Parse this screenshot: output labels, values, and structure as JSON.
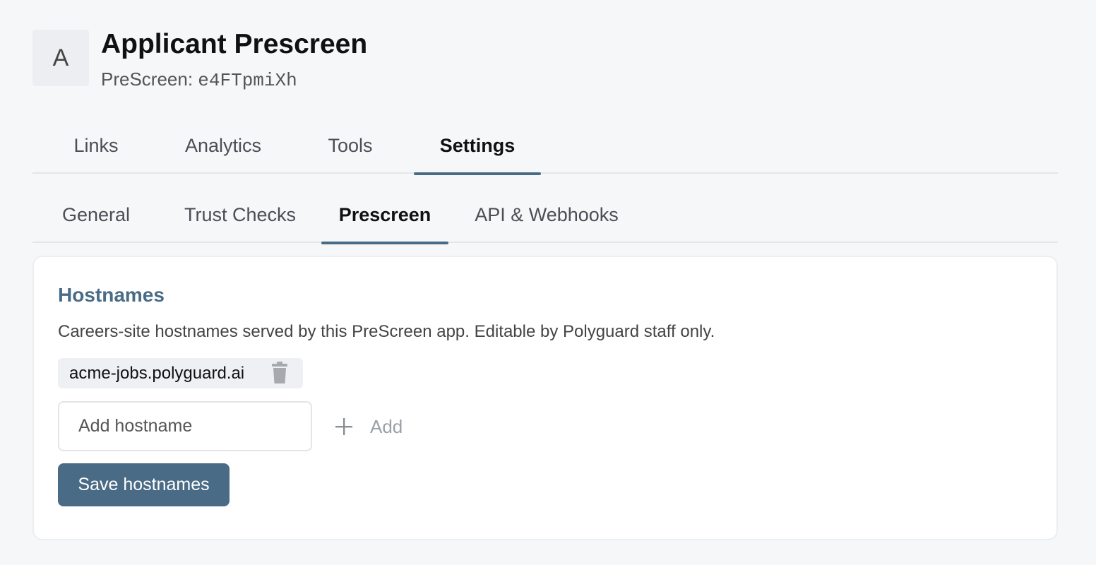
{
  "app": {
    "avatar_letter": "A",
    "title": "Applicant Prescreen",
    "subtitle_prefix": "PreScreen: ",
    "subtitle_id": "e4FTpmiXh"
  },
  "main_tabs": [
    {
      "label": "Links",
      "active": false
    },
    {
      "label": "Analytics",
      "active": false
    },
    {
      "label": "Tools",
      "active": false
    },
    {
      "label": "Settings",
      "active": true
    }
  ],
  "sub_tabs": [
    {
      "label": "General",
      "active": false
    },
    {
      "label": "Trust Checks",
      "active": false
    },
    {
      "label": "Prescreen",
      "active": true
    },
    {
      "label": "API & Webhooks",
      "active": false
    }
  ],
  "hostnames": {
    "title": "Hostnames",
    "description": "Careers-site hostnames served by this PreScreen app. Editable by Polyguard staff only.",
    "items": [
      "acme-jobs.polyguard.ai"
    ],
    "input_placeholder": "Add hostname",
    "input_value": "",
    "add_label": "Add",
    "save_label": "Save hostnames"
  },
  "colors": {
    "accent": "#4a6b85",
    "background": "#f6f7f9",
    "card": "#ffffff"
  }
}
